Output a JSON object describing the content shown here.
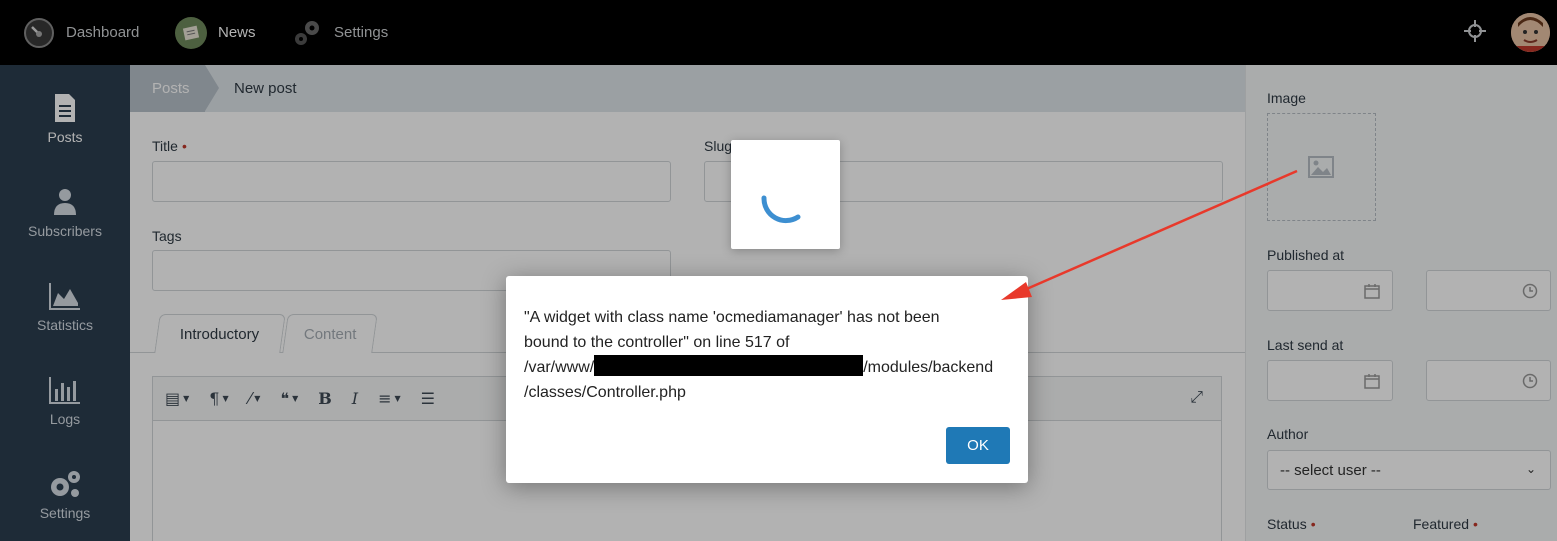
{
  "topnav": {
    "dashboard": "Dashboard",
    "news": "News",
    "settings": "Settings"
  },
  "sidebar": {
    "items": [
      {
        "label": "Posts",
        "icon": "document-icon"
      },
      {
        "label": "Subscribers",
        "icon": "user-icon"
      },
      {
        "label": "Statistics",
        "icon": "area-chart-icon"
      },
      {
        "label": "Logs",
        "icon": "bar-chart-icon"
      },
      {
        "label": "Settings",
        "icon": "gears-icon"
      }
    ]
  },
  "breadcrumb": {
    "parent": "Posts",
    "current": "New post"
  },
  "form": {
    "title_label": "Title",
    "slug_label": "Slug",
    "tags_label": "Tags",
    "title_value": "",
    "slug_value": "",
    "tags_value": ""
  },
  "tabs": [
    "Introductory",
    "Content"
  ],
  "right_panel": {
    "image_label": "Image",
    "published_label": "Published at",
    "last_send_label": "Last send at",
    "author_label": "Author",
    "author_selected": "-- select user --",
    "status_label": "Status",
    "featured_label": "Featured"
  },
  "dialog": {
    "line1": "\"A widget with class name 'ocmediamanager' has not been",
    "line2": "bound to the controller\" on line 517 of",
    "line3_prefix": "/var/www/",
    "line3_suffix": "/modules/backend",
    "line4": "/classes/Controller.php",
    "ok_label": "OK"
  },
  "colors": {
    "topbar": "#000000",
    "sidebar": "#2b3e50",
    "ok_button": "#1f79b6",
    "annotation_arrow": "#e8392b",
    "required_dot": "#c0392b"
  }
}
